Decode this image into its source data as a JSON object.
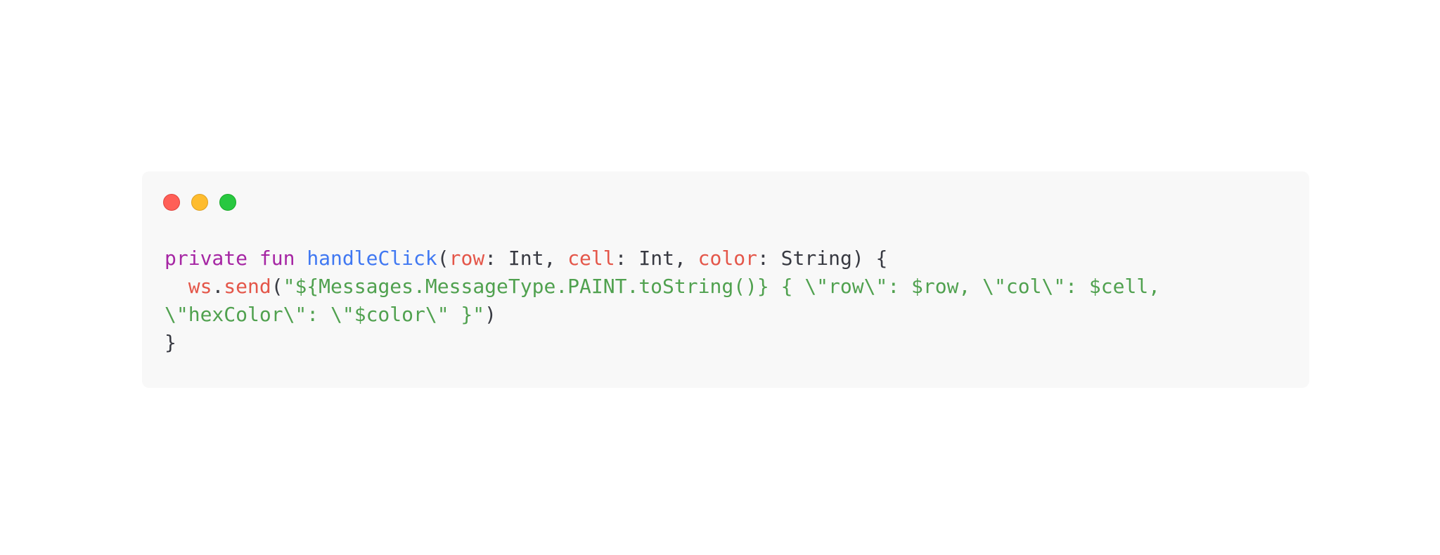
{
  "window": {
    "controls": [
      {
        "name": "close",
        "color": "#ff5f57"
      },
      {
        "name": "minimize",
        "color": "#febc2e"
      },
      {
        "name": "zoom",
        "color": "#28c840"
      }
    ]
  },
  "code": {
    "line1": {
      "kw_private": "private",
      "kw_fun": "fun",
      "fn_name": "handleClick",
      "open_paren": "(",
      "param_row": "row",
      "sep1": ": ",
      "type_int1": "Int",
      "comma1": ", ",
      "param_cell": "cell",
      "sep2": ": ",
      "type_int2": "Int",
      "comma2": ", ",
      "param_color": "color",
      "sep3": ": ",
      "type_string": "String",
      "close": ") {"
    },
    "line2": {
      "indent": "  ",
      "obj": "ws",
      "dot": ".",
      "method": "send",
      "open_paren": "(",
      "string_part1": "\"${Messages.MessageType.PAINT.toString()} { \\\"row\\\": $row, \\\"col\\\": $cell,"
    },
    "line3": {
      "string_part2": "\\\"hexColor\\\": \\\"$color\\\" }\"",
      "close_paren": ")"
    },
    "line4": {
      "close_brace": "}"
    }
  },
  "colors": {
    "keyword": "#a626a4",
    "function": "#4078f2",
    "parameter": "#e45649",
    "string": "#50a14f",
    "default": "#383a42",
    "background": "#f8f8f8"
  }
}
